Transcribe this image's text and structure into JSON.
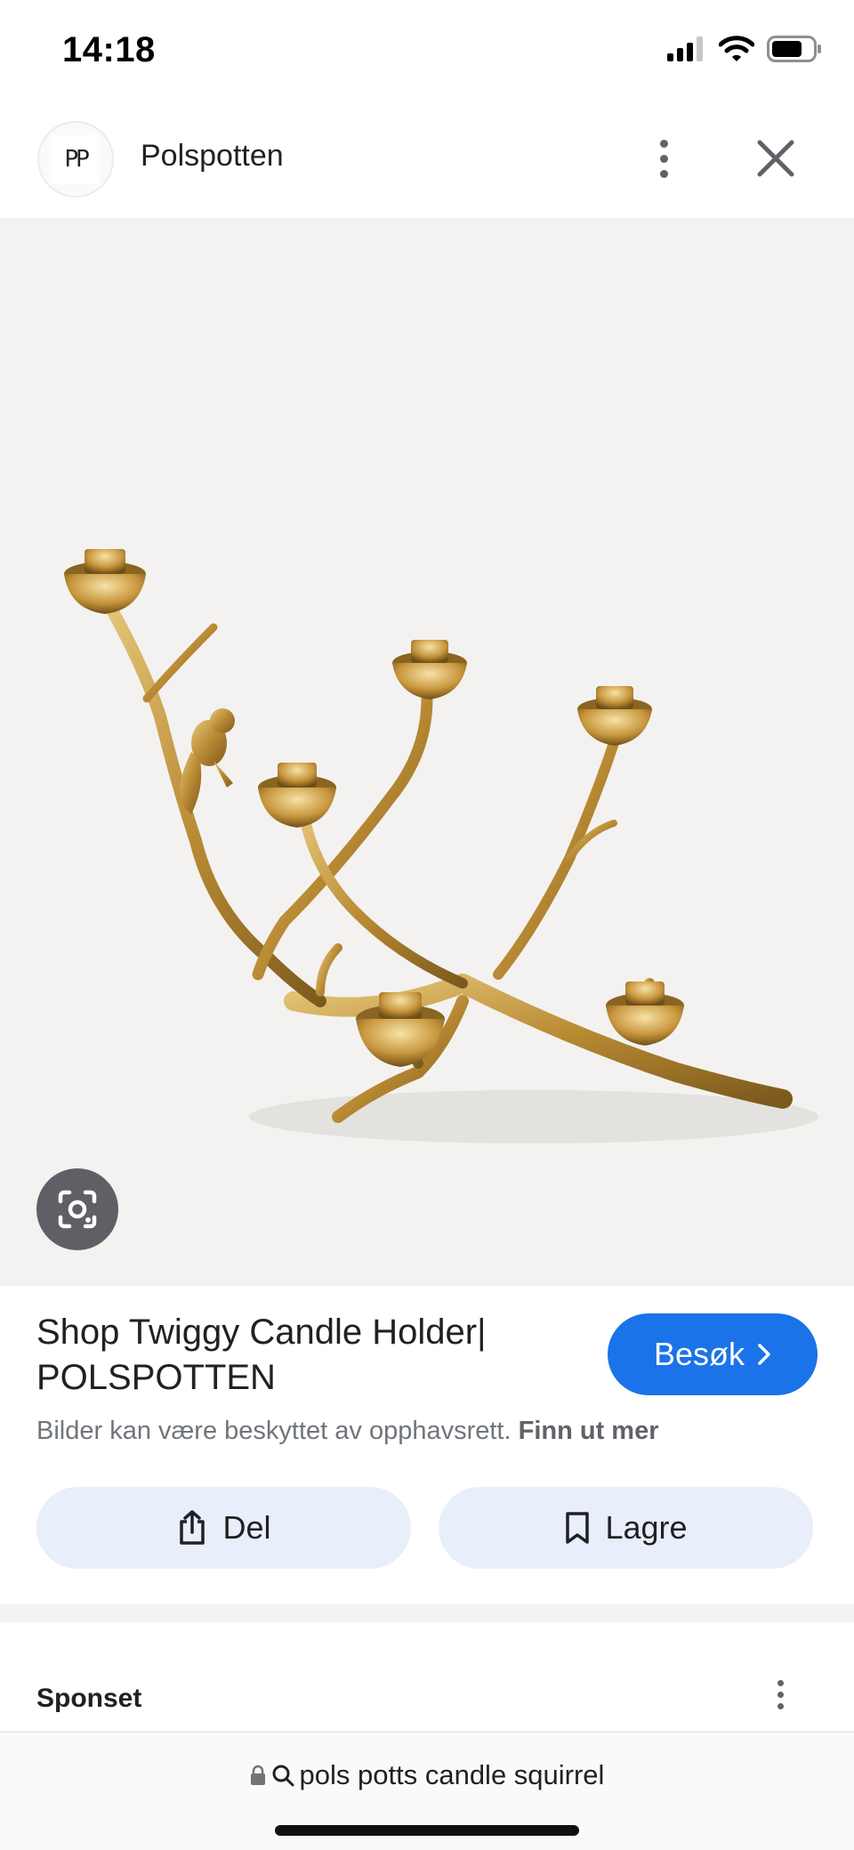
{
  "status_bar": {
    "time": "14:18",
    "icons": [
      "cellular-signal-icon",
      "wifi-icon",
      "battery-icon"
    ]
  },
  "header": {
    "logo_text": "PP",
    "site_name": "Polspotten",
    "icons": [
      "more-vert-icon",
      "close-icon"
    ]
  },
  "image": {
    "lens_icon": "google-lens-icon",
    "background": "#f3f2f0"
  },
  "result": {
    "title": "Shop Twiggy Candle Holder| POLSPOTTEN",
    "visit_label": "Besøk",
    "copyright_text": "Bilder kan være beskyttet av opphavsrett.",
    "learn_more": "Finn ut mer"
  },
  "actions": {
    "share_label": "Del",
    "save_label": "Lagre"
  },
  "sponsored": {
    "label": "Sponset"
  },
  "url_bar": {
    "query": "pols potts candle squirrel"
  },
  "colors": {
    "accent": "#1a73e8",
    "action_button_bg": "#e8eefa",
    "brass": "#c9a04a"
  }
}
